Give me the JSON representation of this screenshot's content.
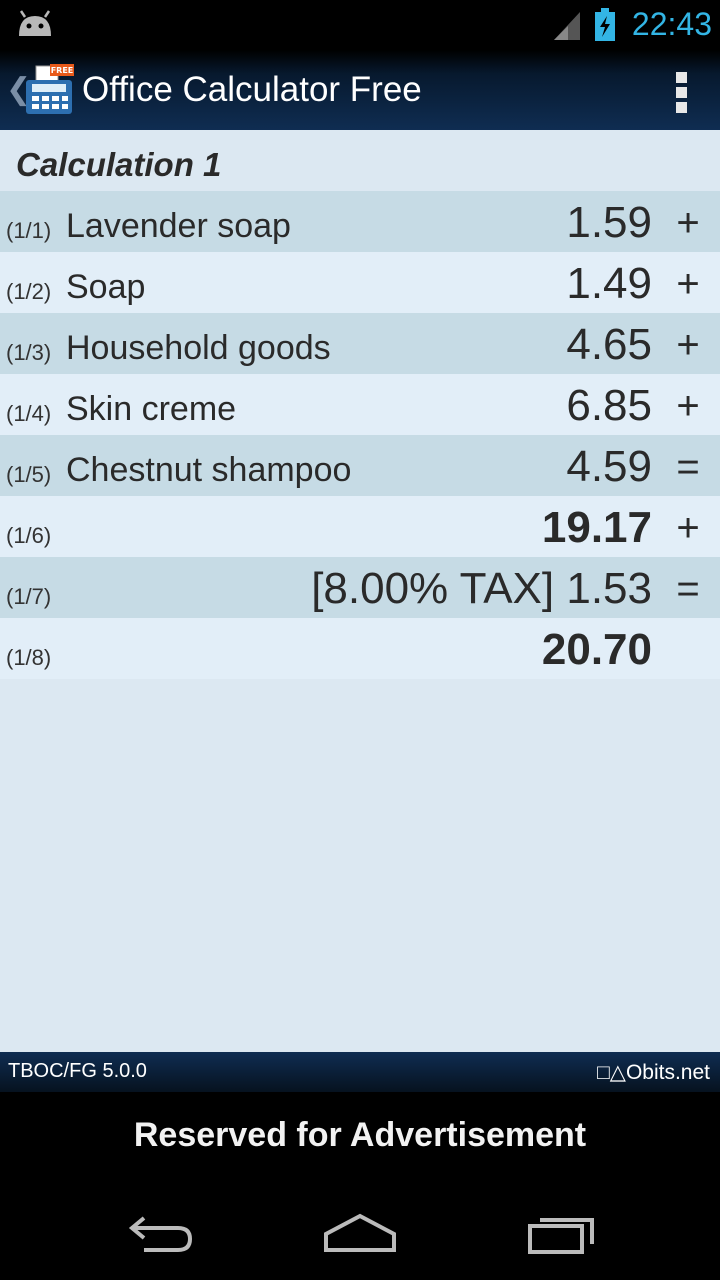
{
  "status_bar": {
    "time": "22:43",
    "icons": [
      "android-icon",
      "signal-icon",
      "battery-charging-icon"
    ]
  },
  "action_bar": {
    "title": "Office Calculator Free",
    "icons": [
      "back-chevron-icon",
      "calculator-app-icon",
      "overflow-menu-icon"
    ],
    "badge": "FREE"
  },
  "calculation": {
    "title": "Calculation 1",
    "rows": [
      {
        "index": "(1/1)",
        "label": "Lavender soap",
        "value": "1.59",
        "op": "+",
        "bold": false
      },
      {
        "index": "(1/2)",
        "label": "Soap",
        "value": "1.49",
        "op": "+",
        "bold": false
      },
      {
        "index": "(1/3)",
        "label": "Household goods",
        "value": "4.65",
        "op": "+",
        "bold": false
      },
      {
        "index": "(1/4)",
        "label": "Skin creme",
        "value": "6.85",
        "op": "+",
        "bold": false
      },
      {
        "index": "(1/5)",
        "label": "Chestnut shampoo",
        "value": "4.59",
        "op": "=",
        "bold": false
      },
      {
        "index": "(1/6)",
        "label": "",
        "value": "19.17",
        "op": "+",
        "bold": true
      },
      {
        "index": "(1/7)",
        "label": "",
        "value": "[8.00% TAX]  1.53",
        "op": "=",
        "bold": false
      },
      {
        "index": "(1/8)",
        "label": "",
        "value": "20.70",
        "op": "",
        "bold": true
      }
    ]
  },
  "footer": {
    "version": "TBOC/FG 5.0.0",
    "brand": "□△Obits.net"
  },
  "ad": {
    "text": "Reserved for Advertisement"
  },
  "nav_bar": {
    "icons": [
      "back-icon",
      "home-icon",
      "recent-apps-icon"
    ]
  },
  "colors": {
    "accent": "#33b5e5",
    "row_odd": "#c6dbe5",
    "row_even": "#e2eef8",
    "background": "#dce8f2"
  }
}
